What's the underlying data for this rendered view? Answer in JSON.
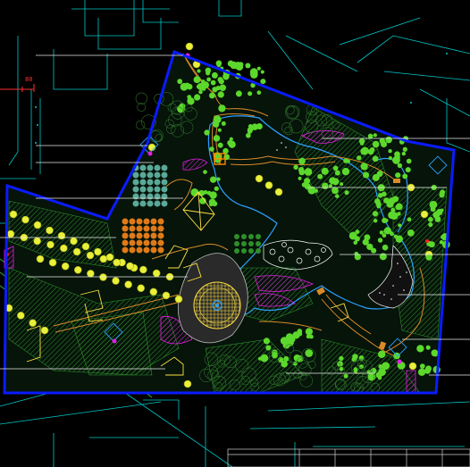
{
  "drawing": {
    "scale_marker": "80",
    "colors": {
      "background": "#000000",
      "site_boundary": "#0a1cff",
      "surroundings": "#00e5e5",
      "leader_lines": "#e8e8e8",
      "path": "#d98a2a",
      "water_edge": "#2aa0ff",
      "tree_green": "#5cd82c",
      "tree_yellow": "#e8f03a",
      "shrub_hatch": "#2f8f2a",
      "flower_magenta": "#e020e0",
      "structure_yellow": "#ffe040",
      "pavilion_orange": "#ff8a00",
      "plaza_grey": "#c0c0c0",
      "accent_red": "#ff2020"
    },
    "icons": [
      "tree-symbol-icon",
      "pavilion-icon",
      "compass-rose-icon"
    ]
  }
}
